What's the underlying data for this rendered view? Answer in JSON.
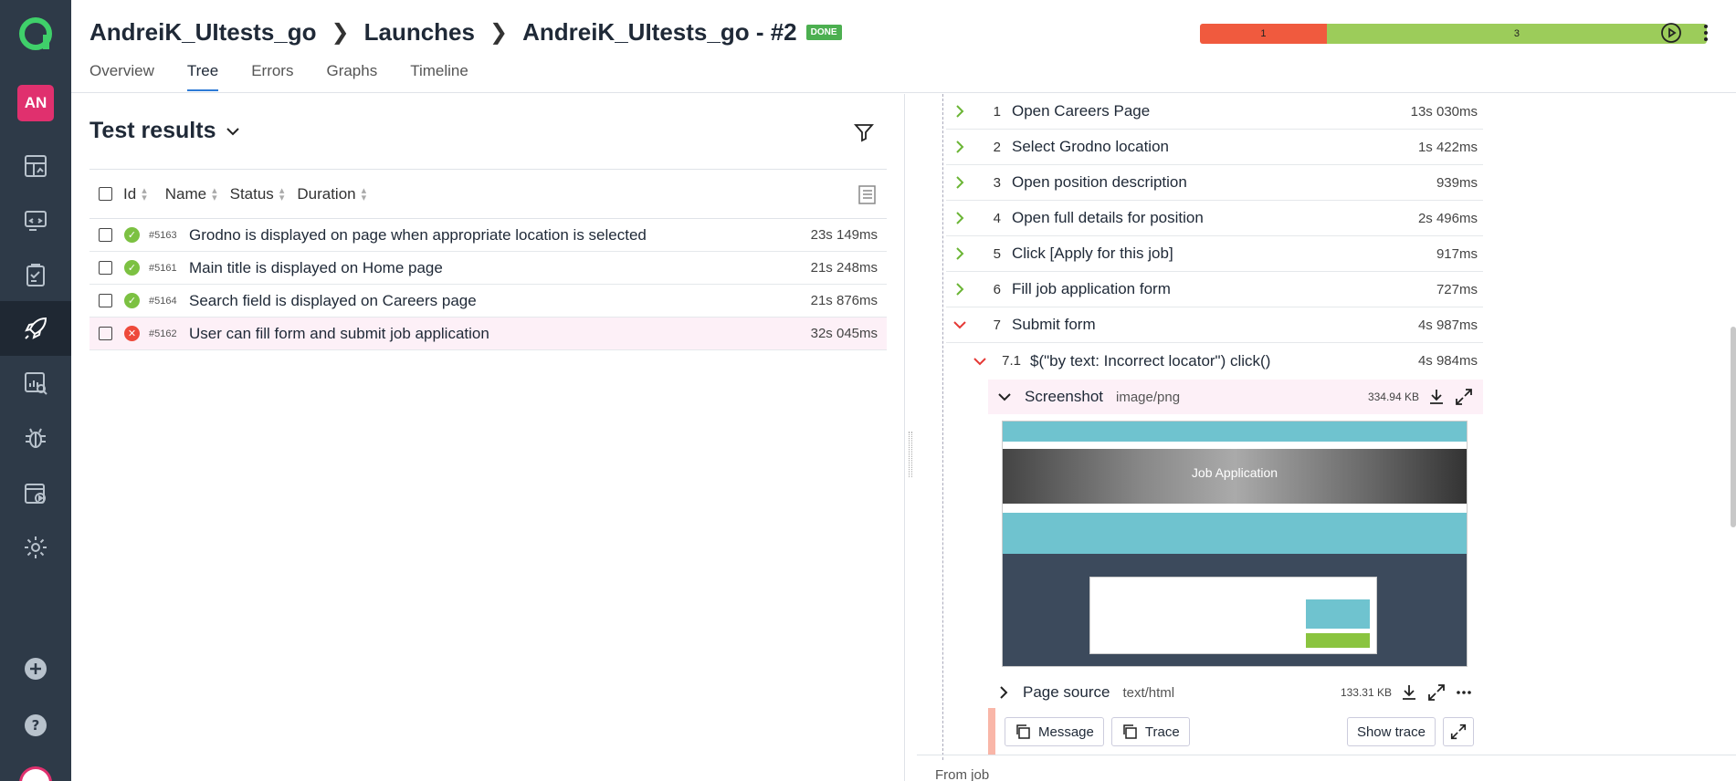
{
  "nav": {
    "avatar_initials": "AN",
    "items": [
      "dashboard",
      "launches",
      "debug",
      "filters",
      "analytics",
      "defects",
      "plugins",
      "settings"
    ]
  },
  "header": {
    "crumb_project": "AndreiK_UItests_go",
    "crumb_launches": "Launches",
    "crumb_launch": "AndreiK_UItests_go - #2",
    "done_badge": "DONE",
    "tabs": [
      "Overview",
      "Tree",
      "Errors",
      "Graphs",
      "Timeline"
    ],
    "active_tab": "Tree",
    "status_failed": "1",
    "status_passed": "3",
    "failed_fraction": 0.25,
    "colors": {
      "failed": "#f05a3e",
      "passed": "#9ccc5a",
      "accent": "#2e7bd6"
    }
  },
  "left": {
    "title": "Test results",
    "columns": [
      "Id",
      "Name",
      "Status",
      "Duration"
    ],
    "rows": [
      {
        "id": "#5163",
        "name": "Grodno is displayed on page when appropriate location is selected",
        "status": "passed",
        "duration": "23s 149ms"
      },
      {
        "id": "#5161",
        "name": "Main title is displayed on Home page",
        "status": "passed",
        "duration": "21s 248ms"
      },
      {
        "id": "#5164",
        "name": "Search field is displayed on Careers page",
        "status": "passed",
        "duration": "21s 876ms"
      },
      {
        "id": "#5162",
        "name": "User can fill form and submit job application",
        "status": "failed",
        "duration": "32s 045ms"
      }
    ]
  },
  "right": {
    "steps": [
      {
        "num": "1",
        "name": "Open Careers Page",
        "duration": "13s 030ms",
        "status": "passed"
      },
      {
        "num": "2",
        "name": "Select Grodno location",
        "duration": "1s 422ms",
        "status": "passed"
      },
      {
        "num": "3",
        "name": "Open position description",
        "duration": "939ms",
        "status": "passed"
      },
      {
        "num": "4",
        "name": "Open full details for position",
        "duration": "2s 496ms",
        "status": "passed"
      },
      {
        "num": "5",
        "name": "Click [Apply for this job]",
        "duration": "917ms",
        "status": "passed"
      },
      {
        "num": "6",
        "name": "Fill job application form",
        "duration": "727ms",
        "status": "passed"
      },
      {
        "num": "7",
        "name": "Submit form",
        "duration": "4s 987ms",
        "status": "failed"
      }
    ],
    "substep": {
      "num": "7.1",
      "name": "$(\"by text: Incorrect locator\") click()",
      "duration": "4s 984ms"
    },
    "screenshot_attach": {
      "label": "Screenshot",
      "type": "image/png",
      "size": "334.94 KB"
    },
    "screenshot_title": "Job Application",
    "page_source_attach": {
      "label": "Page source",
      "type": "text/html",
      "size": "133.31 KB"
    },
    "buttons": {
      "message": "Message",
      "trace": "Trace",
      "show_trace": "Show trace"
    },
    "from_job": "From job"
  }
}
